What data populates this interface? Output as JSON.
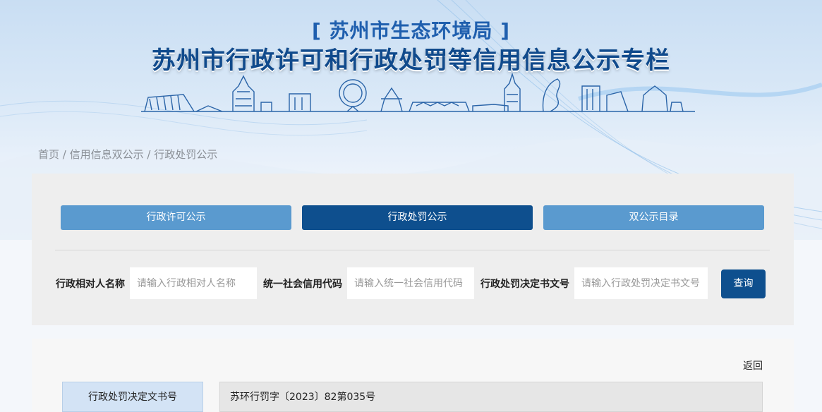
{
  "header": {
    "org_title": "[ 苏州市生态环境局 ]",
    "main_title": "苏州市行政许可和行政处罚等信用信息公示专栏"
  },
  "breadcrumb": {
    "home": "首页",
    "sep": " / ",
    "level2": "信用信息双公示",
    "level3": "行政处罚公示"
  },
  "tabs": [
    {
      "label": "行政许可公示",
      "active": false
    },
    {
      "label": "行政处罚公示",
      "active": true
    },
    {
      "label": "双公示目录",
      "active": false
    }
  ],
  "search": {
    "name_label": "行政相对人名称",
    "name_placeholder": "请输入行政相对人名称",
    "code_label": "统一社会信用代码",
    "code_placeholder": "请输入统一社会信用代码",
    "doc_label": "行政处罚决定书文号",
    "doc_placeholder": "请输入行政处罚决定书文号",
    "query_label": "查询"
  },
  "detail": {
    "back_label": "返回",
    "rows": [
      {
        "label": "行政处罚决定文书号",
        "value": "苏环行罚字〔2023〕82第035号"
      }
    ]
  },
  "colors": {
    "primary": "#0e4f8e",
    "tab_light": "#5a9acf",
    "title": "#104a8c"
  }
}
